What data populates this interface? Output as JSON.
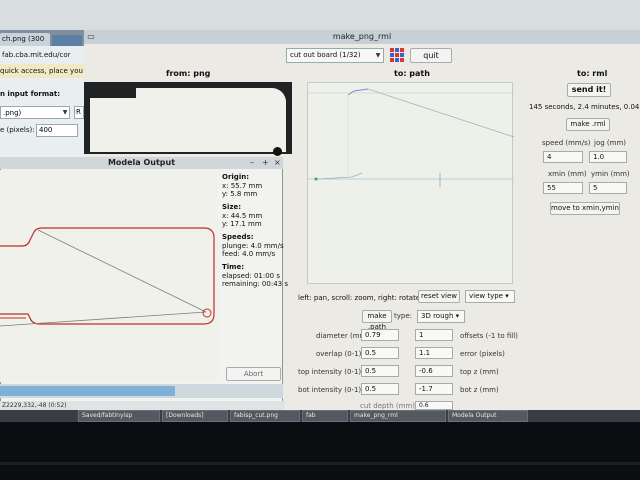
{
  "browser": {
    "tab_label": "ch.png (300",
    "url": "fab.cba.mit.edu/cor",
    "notice": "quick access, place you",
    "input_format_label": "n input format:",
    "format_select": ".png)",
    "r_field": "R",
    "pixels_label": "e (pixels):",
    "pixels_value": "400"
  },
  "app": {
    "title": "make_png_rml",
    "process_select": "cut out board (1/32)",
    "quit_label": "quit",
    "headers": {
      "from_png": "from: png",
      "to_path": "to: path",
      "to_rml": "to: rml"
    },
    "path_help": "left: pan, scroll: zoom, right: rotate",
    "reset_view": "reset view",
    "view_type": "view type",
    "make_path": "make .path",
    "type_label": "type:",
    "type_value": "3D rough",
    "params": [
      {
        "label": "diameter (mm)",
        "value": "0.79",
        "right_value": "1",
        "right_label": "offsets (-1 to fill)"
      },
      {
        "label": "overlap (0-1)",
        "value": "0.5",
        "right_value": "1.1",
        "right_label": "error (pixels)"
      },
      {
        "label": "top intensity (0-1)",
        "value": "0.5",
        "right_value": "-0.6",
        "right_label": "top z (mm)"
      },
      {
        "label": "bot intensity (0-1)",
        "value": "0.5",
        "right_value": "-1.7",
        "right_label": "bot z (mm)"
      }
    ],
    "cut_depth_label": "cut depth (mm)",
    "cut_depth_value": "0.6",
    "rml": {
      "send_label": "send it!",
      "time_text": "145 seconds, 2.4 minutes, 0.04 ho",
      "make_rml": "make .rml",
      "speed_label": "speed (mm/s)",
      "jog_label": "jog (mm)",
      "speed_value": "4",
      "jog_value": "1.0",
      "xmin_label": "xmin (mm)",
      "ymin_label": "ymin (mm)",
      "xmin_value": "55",
      "ymin_value": "5",
      "move_label": "move to xmin,ymin"
    }
  },
  "modela": {
    "title": "Modela Output",
    "controls": [
      "–",
      "+",
      "×"
    ],
    "origin_label": "Origin:",
    "origin_x": "x: 55.7 mm",
    "origin_y": "y: 5.8 mm",
    "size_label": "Size:",
    "size_x": "x: 44.5 mm",
    "size_y": "y: 17.1 mm",
    "speeds_label": "Speeds:",
    "plunge": "plunge: 4.0 mm/s",
    "feed": "feed: 4.0 mm/s",
    "time_label": "Time:",
    "elapsed": "elapsed: 01:00 s",
    "remaining": "remaining: 00:43 s",
    "abort": "Abort",
    "status": "Z2229,332,-48 (0:52)",
    "progress": 0.62
  },
  "taskbar": {
    "items": [
      "Saved/fabtinyisp",
      "[Downloads]",
      "fabisp_cut.png",
      "fab",
      "make_png_rml",
      "Modela Output"
    ]
  },
  "colors": {
    "toolpath": "#c0302a",
    "progress": "#7fb1d6",
    "accent": "#2a5fa8"
  }
}
